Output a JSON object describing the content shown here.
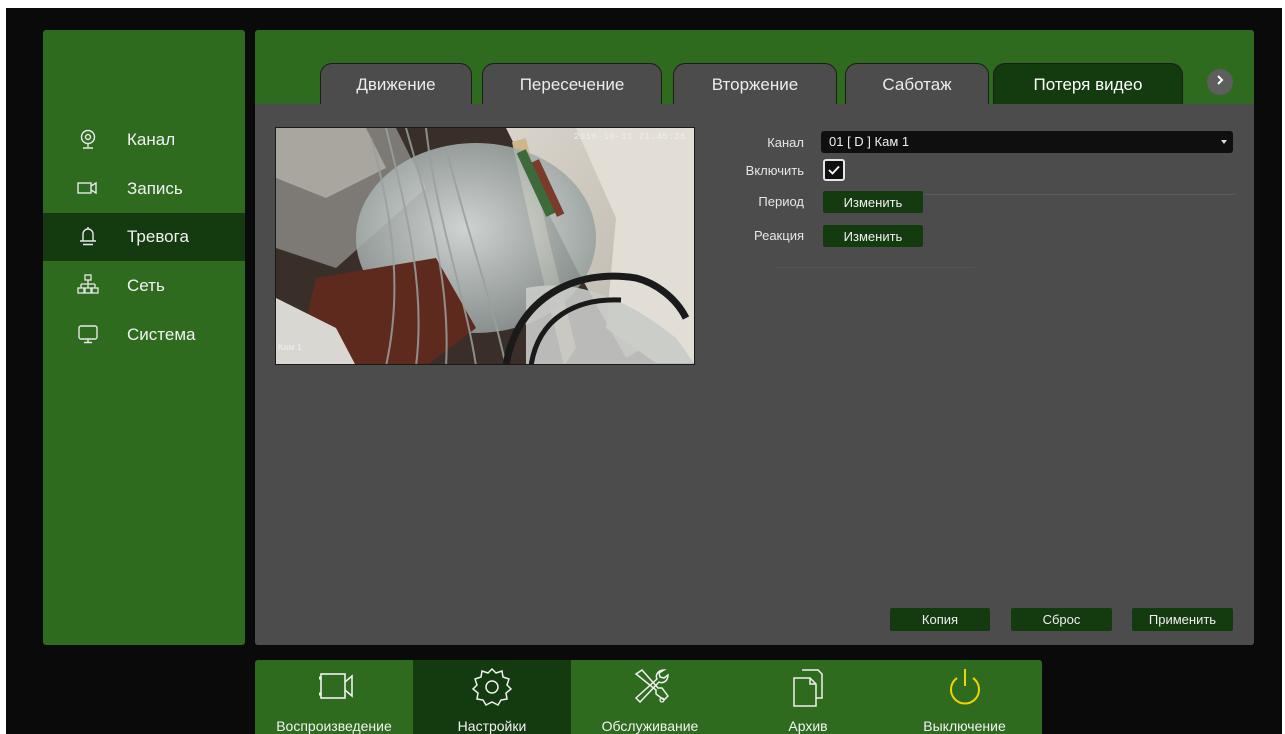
{
  "sidebar": {
    "items": [
      {
        "label": "Канал",
        "icon": "camera-channel-icon"
      },
      {
        "label": "Запись",
        "icon": "record-camera-icon"
      },
      {
        "label": "Тревога",
        "icon": "bell-icon"
      },
      {
        "label": "Сеть",
        "icon": "network-icon"
      },
      {
        "label": "Система",
        "icon": "monitor-icon"
      }
    ],
    "active": "Тревога"
  },
  "tabs": {
    "items": [
      "Движение",
      "Пересечение",
      "Вторжение",
      "Саботаж",
      "Потеря видео"
    ],
    "active": "Потеря видео",
    "next_icon": "chevron-right-icon"
  },
  "preview": {
    "timestamp": "2016-10-31 21:45:35",
    "camera_name": "Кам 1"
  },
  "form": {
    "channel_label": "Канал",
    "channel_value": "01 [ D ] Кам 1",
    "enable_label": "Включить",
    "enable_checked": true,
    "period_label": "Период",
    "period_button": "Изменить",
    "reaction_label": "Реакция",
    "reaction_button": "Изменить"
  },
  "actions": {
    "copy": "Копия",
    "reset": "Сброс",
    "apply": "Применить"
  },
  "dock": {
    "items": [
      {
        "label": "Воспроизведение",
        "icon": "playback-camera-icon"
      },
      {
        "label": "Настройки",
        "icon": "settings-gear-icon"
      },
      {
        "label": "Обслуживание",
        "icon": "maintenance-tools-icon"
      },
      {
        "label": "Архив",
        "icon": "archive-files-icon"
      },
      {
        "label": "Выключение",
        "icon": "power-icon"
      }
    ],
    "active": "Настройки"
  },
  "colors": {
    "panel_green": "#2e6b1f",
    "active_dark_green": "#143a10",
    "content_gray": "#4c4c4c",
    "power_icon_yellow": "#f2d400"
  }
}
